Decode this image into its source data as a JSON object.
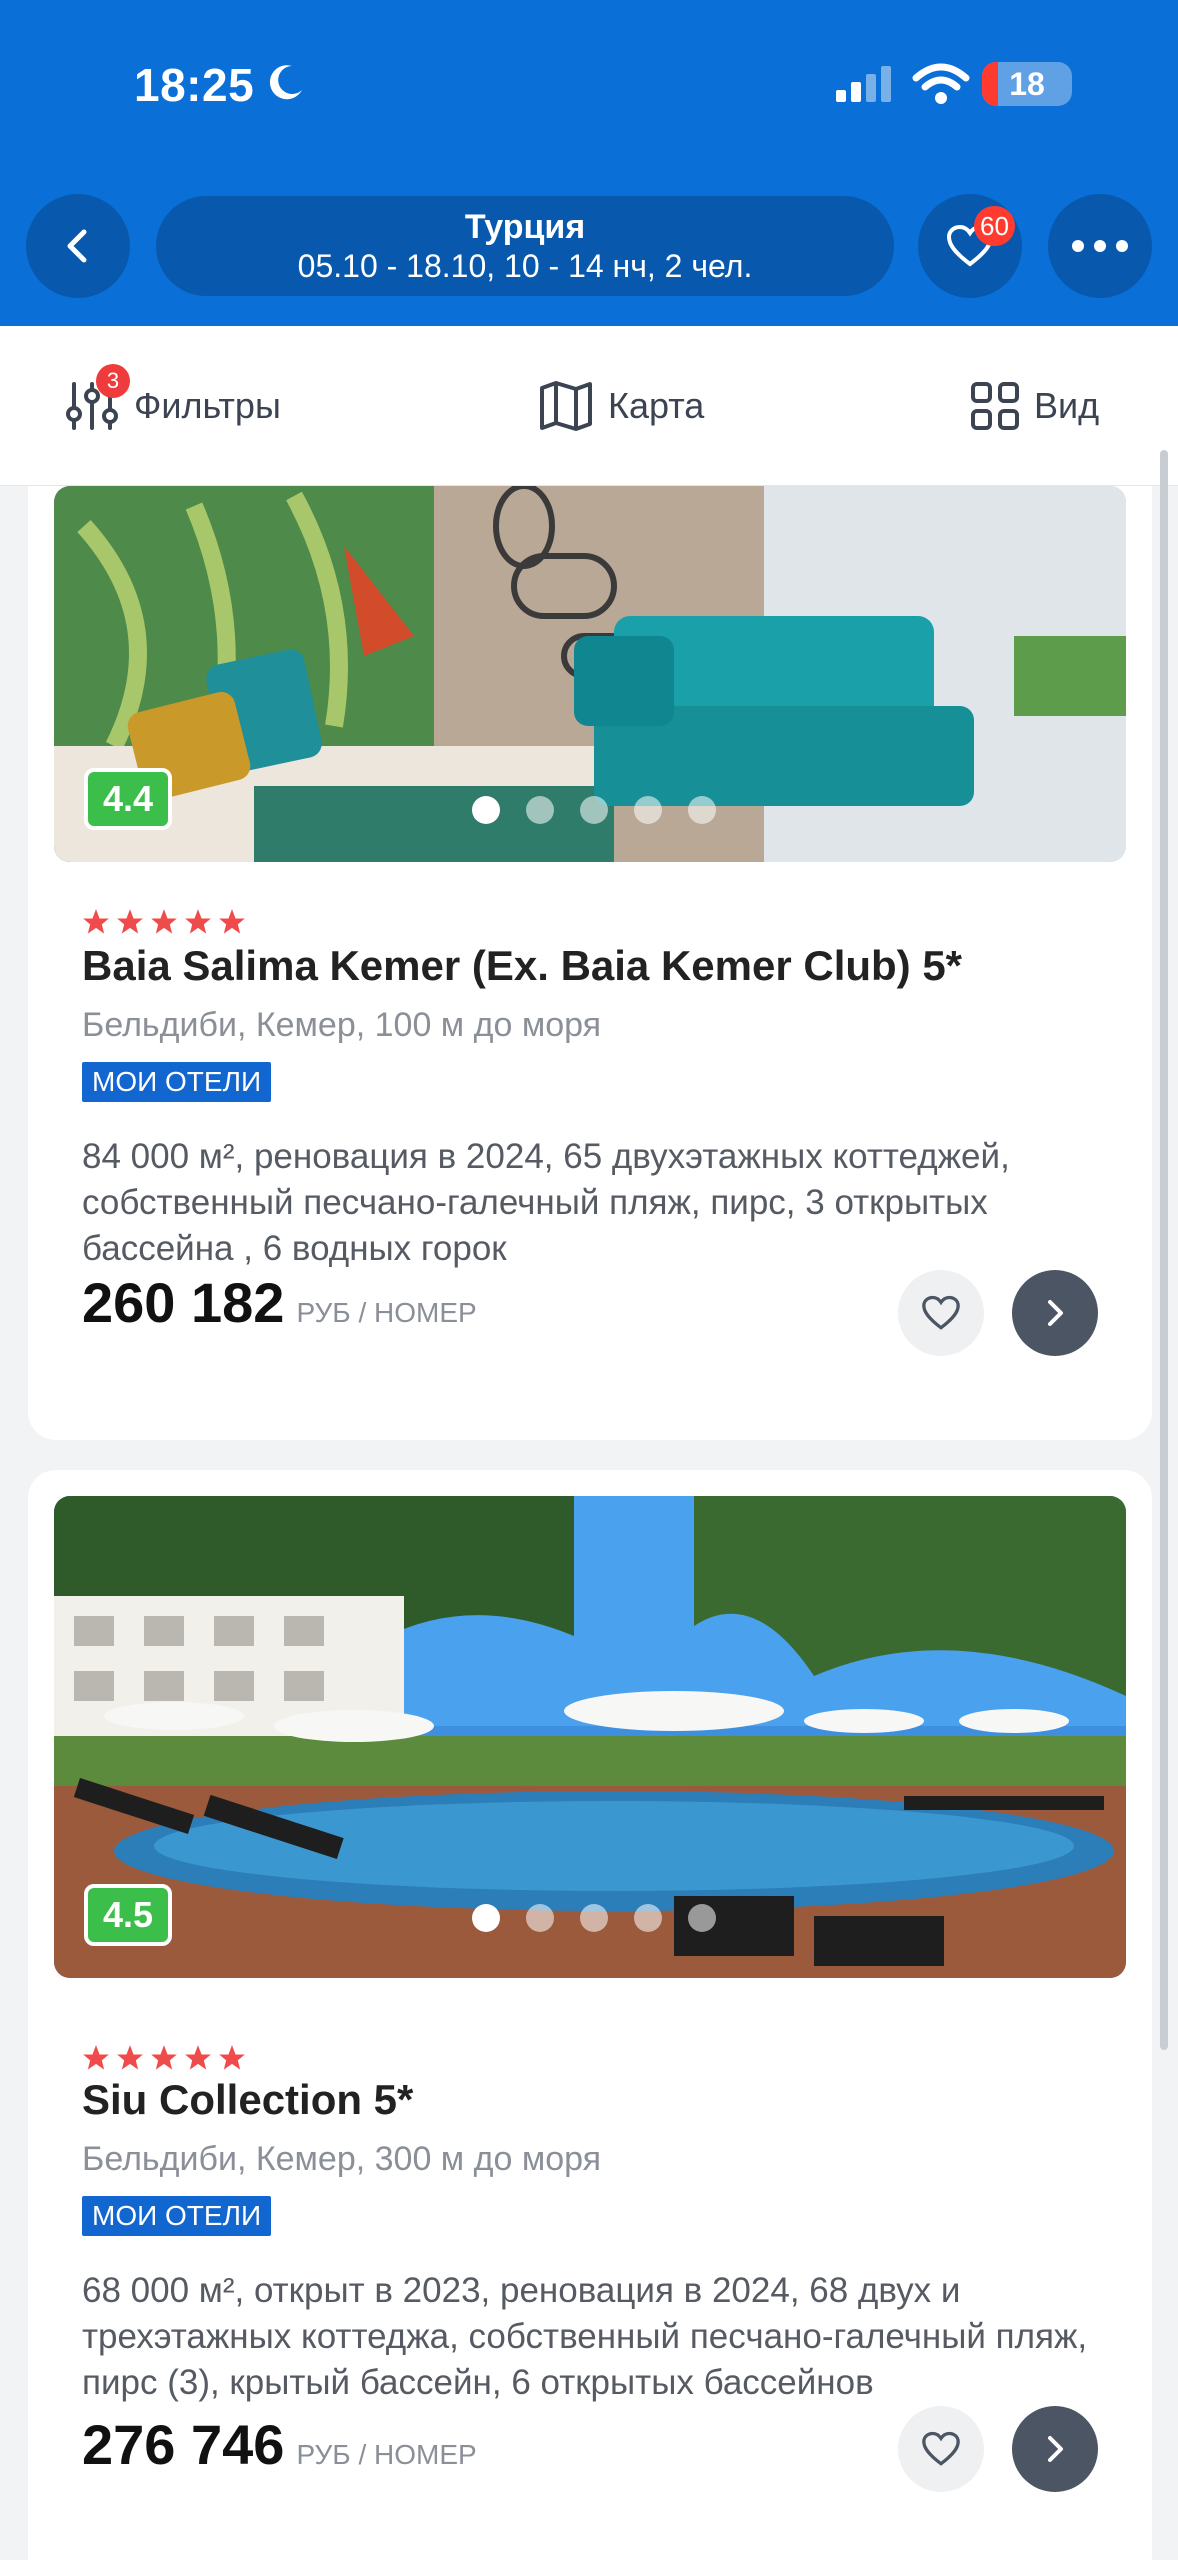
{
  "status_bar": {
    "time": "18:25",
    "battery": "18",
    "battery_level": 0.18
  },
  "header": {
    "title": "Турция",
    "subtitle": "05.10 - 18.10, 10 - 14 нч, 2 чел.",
    "favorites_count": "60",
    "icons": {
      "back": "chevron-left-icon",
      "favorites": "heart-icon",
      "more": "more-dots-icon"
    }
  },
  "toolbar": {
    "filters_label": "Фильтры",
    "filters_count": "3",
    "map_label": "Карта",
    "view_label": "Вид"
  },
  "colors": {
    "header_blue": "#0a6fd6",
    "header_button": "#0859ad",
    "rating_green": "#3cbf4a",
    "badge_blue": "#1266cf",
    "star_red": "#f04b4b"
  },
  "hotels": [
    {
      "rating": "4.4",
      "stars": 5,
      "name": "Baia Salima Kemer (Ex. Baia Kemer Club) 5*",
      "location": "Бельдиби, Кемер, 100 м до моря",
      "badge": "МОИ ОТЕЛИ",
      "description": "84 000 м², реновация в 2024, 65 двухэтажных коттеджей, собственный песчано-галечный пляж, пирс, 3 открытых бассейна , 6 водных горок",
      "price": "260 182",
      "price_unit": "РУБ / НОМЕР",
      "photo_count": 5,
      "active_photo": 0
    },
    {
      "rating": "4.5",
      "stars": 5,
      "name": "Siu Collection 5*",
      "location": "Бельдиби, Кемер, 300 м до моря",
      "badge": "МОИ ОТЕЛИ",
      "description": "68 000 м², открыт в 2023, реновация в 2024, 68 двух и трехэтажных коттеджа, собственный песчано-галечный пляж, пирс (3), крытый бассейн, 6 открытых бассейнов",
      "price": "276 746",
      "price_unit": "РУБ / НОМЕР",
      "photo_count": 5,
      "active_photo": 0
    }
  ]
}
